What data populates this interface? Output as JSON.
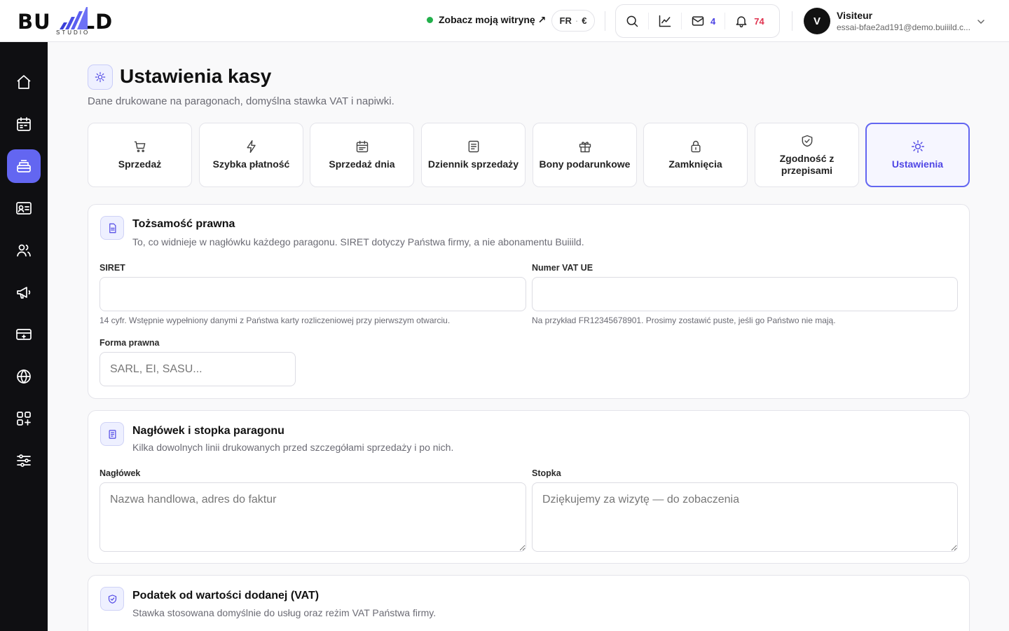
{
  "brand": {
    "logo_left": "BU",
    "logo_right": "LD",
    "logo_sub": "STUDIO"
  },
  "topbar": {
    "site_link": "Zobacz moją witrynę ↗",
    "lang": "FR",
    "lang_sep": "·",
    "currency": "€",
    "messages_count": "4",
    "notifications_count": "74",
    "user_initial": "V",
    "user_name": "Visiteur",
    "user_email": "essai-bfae2ad191@demo.buiiild.c..."
  },
  "sidebar": {
    "items": [
      {
        "icon": "home-icon"
      },
      {
        "icon": "calendar-icon"
      },
      {
        "icon": "register-icon",
        "active": true
      },
      {
        "icon": "contact-card-icon"
      },
      {
        "icon": "users-icon"
      },
      {
        "icon": "megaphone-icon"
      },
      {
        "icon": "payment-card-icon"
      },
      {
        "icon": "globe-icon"
      },
      {
        "icon": "apps-icon"
      },
      {
        "icon": "sliders-icon"
      }
    ]
  },
  "page": {
    "title": "Ustawienia kasy",
    "subtitle": "Dane drukowane na paragonach, domyślna stawka VAT i napiwki."
  },
  "tabs": [
    {
      "label": "Sprzedaż",
      "icon": "cart-icon"
    },
    {
      "label": "Szybka płatność",
      "icon": "lightning-icon"
    },
    {
      "label": "Sprzedaż dnia",
      "icon": "calendar-icon"
    },
    {
      "label": "Dziennik sprzedaży",
      "icon": "journal-icon"
    },
    {
      "label": "Bony podarunkowe",
      "icon": "gift-icon"
    },
    {
      "label": "Zamknięcia",
      "icon": "lock-icon"
    },
    {
      "label": "Zgodność z przepisami",
      "icon": "shield-check-icon"
    },
    {
      "label": "Ustawienia",
      "icon": "sun-gear-icon",
      "active": true
    }
  ],
  "legal": {
    "title": "Tożsamość prawna",
    "subtitle": "To, co widnieje w nagłówku każdego paragonu. SIRET dotyczy Państwa firmy, a nie abonamentu Buiiild.",
    "siret_label": "SIRET",
    "siret_value": "",
    "siret_hint": "14 cyfr. Wstępnie wypełniony danymi z Państwa karty rozliczeniowej przy pierwszym otwarciu.",
    "vat_label": "Numer VAT UE",
    "vat_value": "",
    "vat_hint": "Na przykład FR12345678901. Prosimy zostawić puste, jeśli go Państwo nie mają.",
    "form_label": "Forma prawna",
    "form_placeholder": "SARL, EI, SASU..."
  },
  "receipt": {
    "title": "Nagłówek i stopka paragonu",
    "subtitle": "Kilka dowolnych linii drukowanych przed szczegółami sprzedaży i po nich.",
    "header_label": "Nagłówek",
    "header_placeholder": "Nazwa handlowa, adres do faktur",
    "footer_label": "Stopka",
    "footer_placeholder": "Dziękujemy za wizytę — do zobaczenia"
  },
  "vat": {
    "title": "Podatek od wartości dodanej (VAT)",
    "subtitle": "Stawka stosowana domyślnie do usług oraz reżim VAT Państwa firmy."
  },
  "colors": {
    "accent": "#6366f1",
    "sidebar_bg": "#0f0f12",
    "status_green": "#22b04b",
    "badge_red": "#e0334f"
  }
}
